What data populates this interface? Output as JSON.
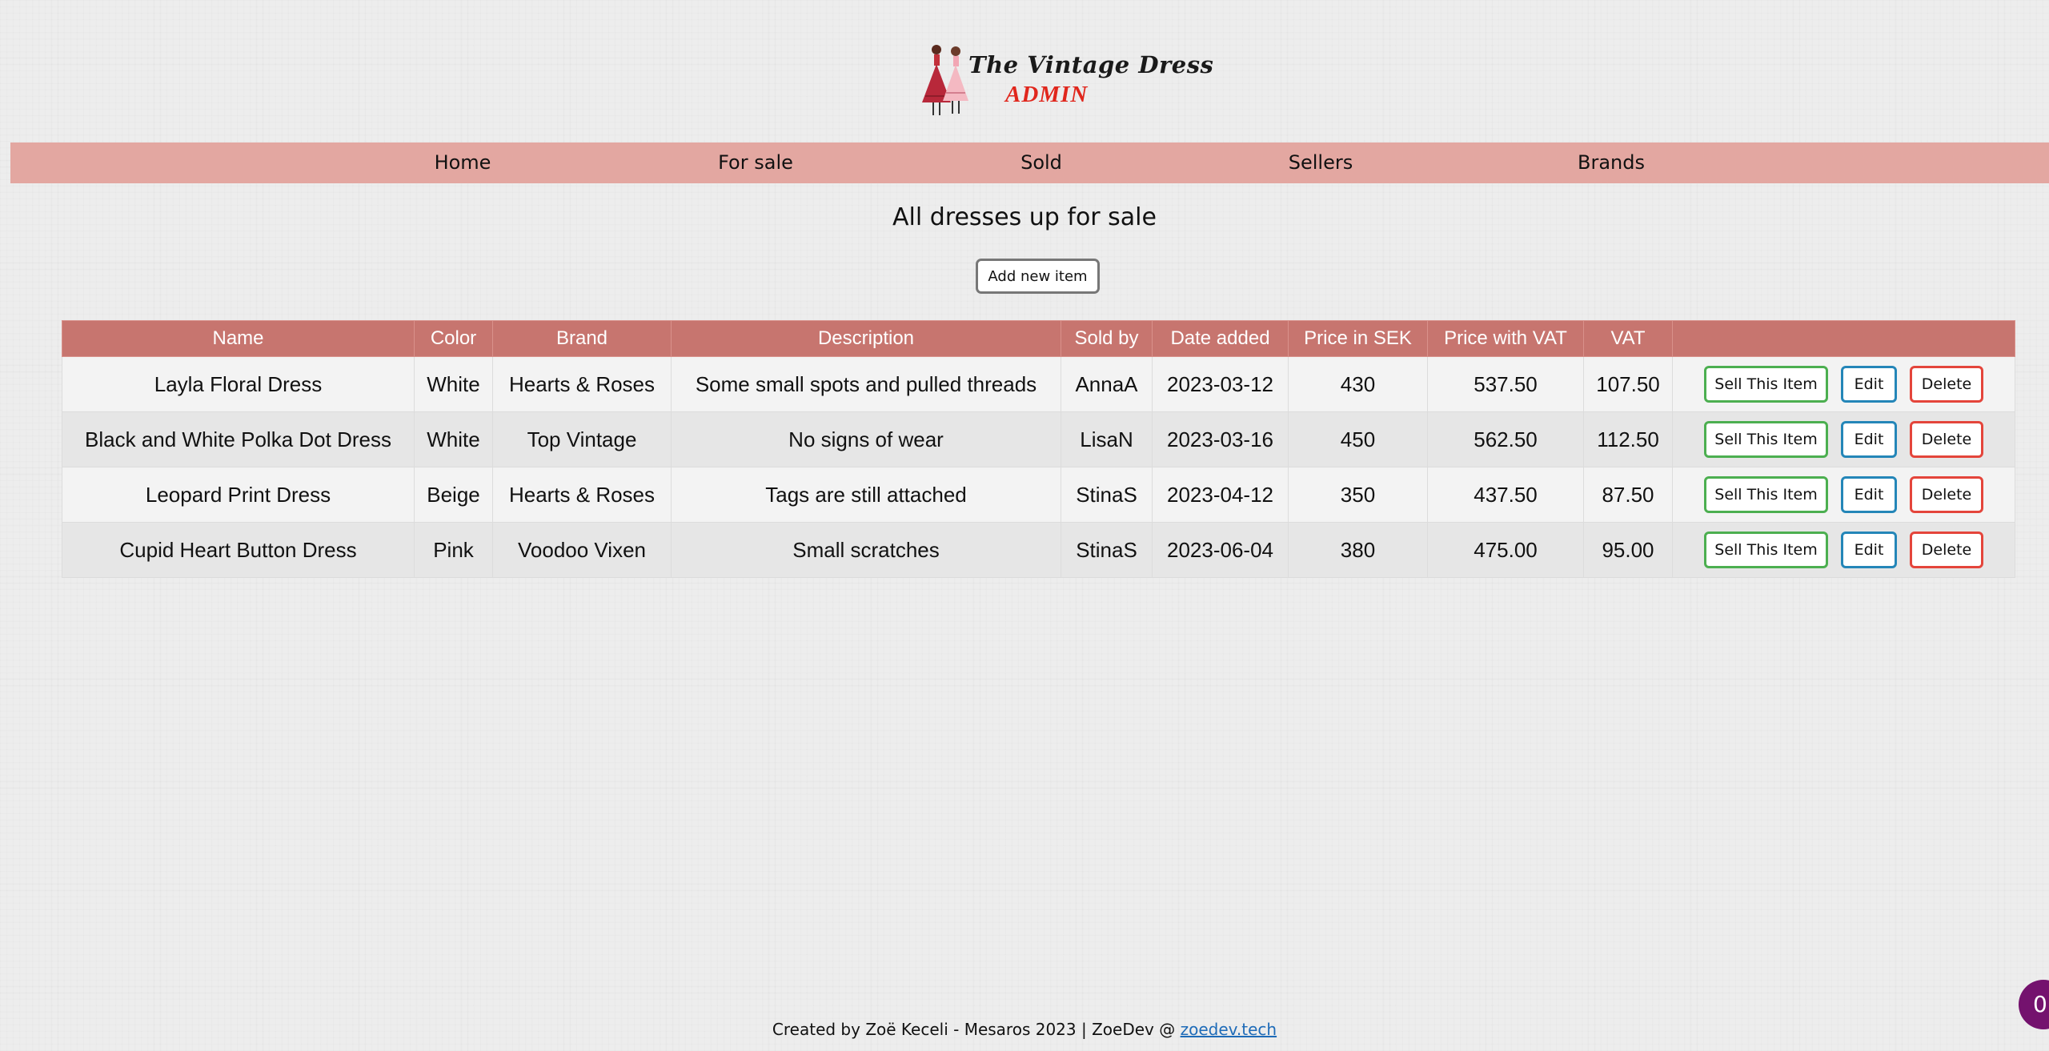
{
  "logo": {
    "title": "The Vintage Dress",
    "subtitle": "ADMIN"
  },
  "nav": {
    "items": [
      "Home",
      "For sale",
      "Sold",
      "Sellers",
      "Brands"
    ]
  },
  "page": {
    "heading": "All dresses up for sale",
    "add_button": "Add new item"
  },
  "table": {
    "headers": [
      "Name",
      "Color",
      "Brand",
      "Description",
      "Sold by",
      "Date added",
      "Price in SEK",
      "Price with VAT",
      "VAT",
      ""
    ],
    "rows": [
      [
        "Layla Floral Dress",
        "White",
        "Hearts & Roses",
        "Some small spots and pulled threads",
        "AnnaA",
        "2023-03-12",
        "430",
        "537.50",
        "107.50"
      ],
      [
        "Black and White Polka Dot Dress",
        "White",
        "Top Vintage",
        "No signs of wear",
        "LisaN",
        "2023-03-16",
        "450",
        "562.50",
        "112.50"
      ],
      [
        "Leopard Print Dress",
        "Beige",
        "Hearts & Roses",
        "Tags are still attached",
        "StinaS",
        "2023-04-12",
        "350",
        "437.50",
        "87.50"
      ],
      [
        "Cupid Heart Button Dress",
        "Pink",
        "Voodoo Vixen",
        "Small scratches",
        "StinaS",
        "2023-06-04",
        "380",
        "475.00",
        "95.00"
      ]
    ],
    "actions": {
      "sell": "Sell This Item",
      "edit": "Edit",
      "delete": "Delete"
    }
  },
  "footer": {
    "text": "Created by Zoë Keceli - Mesaros 2023 | ZoeDev @ ",
    "link": "zoedev.tech"
  },
  "badge": {
    "count": "0"
  },
  "colors": {
    "nav_bg": "#e3a7a1",
    "header_bg": "#c7756f",
    "sell": "#4caf50",
    "edit": "#2486b8",
    "delete": "#e4453b",
    "logo_accent": "#e0261c"
  }
}
